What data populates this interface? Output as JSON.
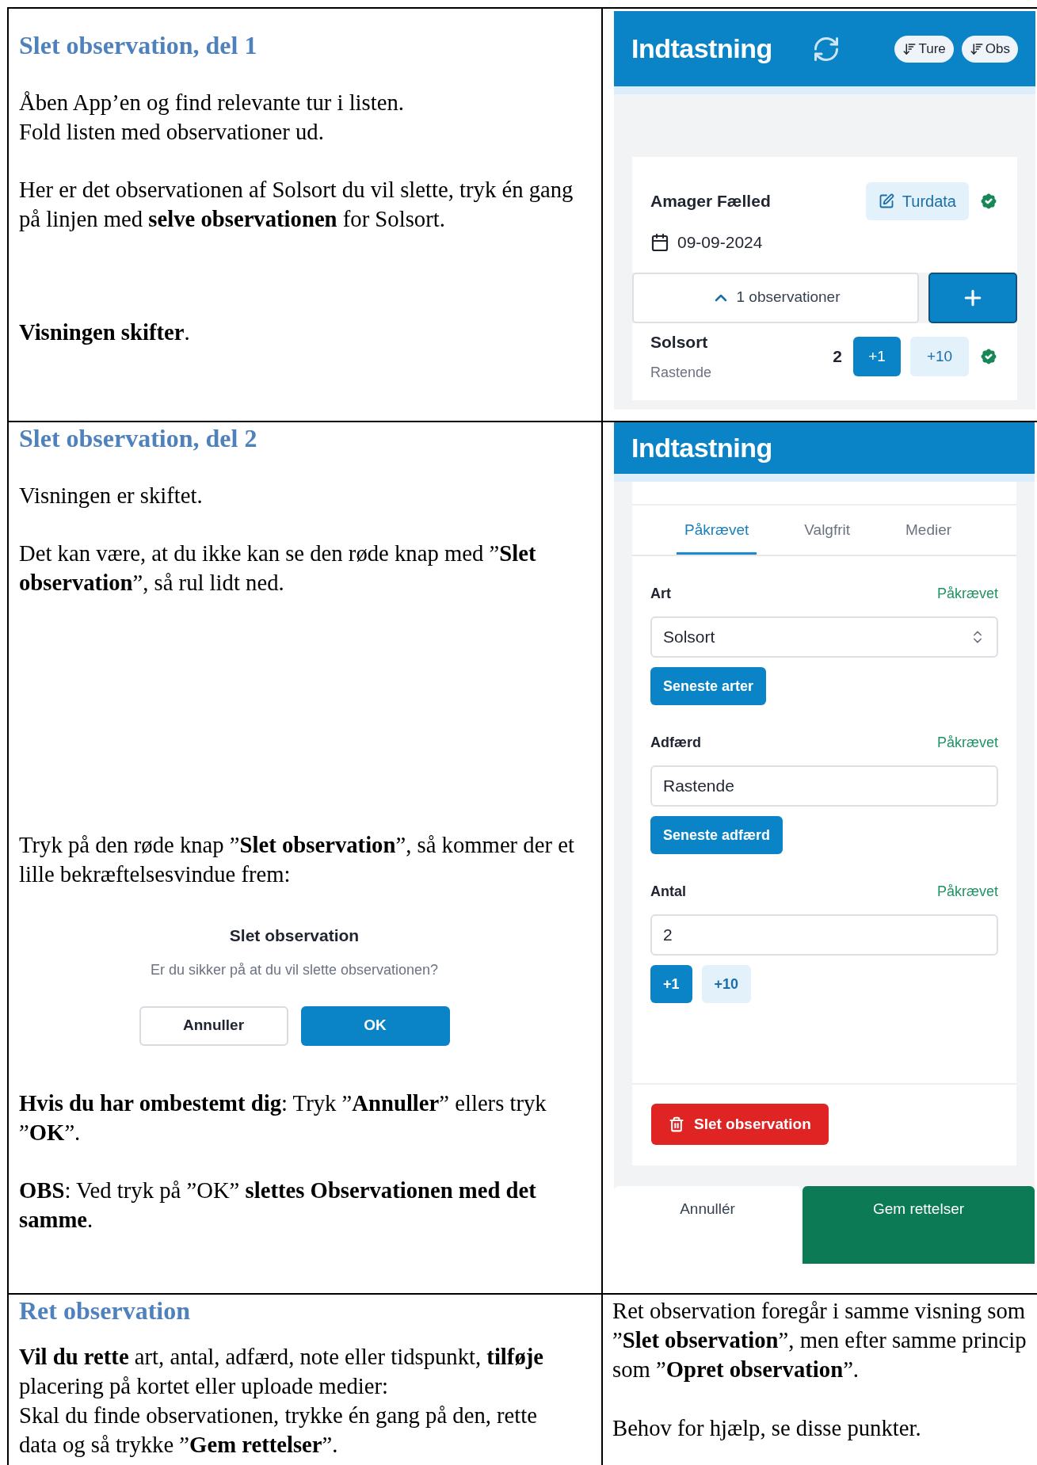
{
  "rows": [
    {
      "left": {
        "heading": "Slet observation, del 1",
        "blocks": [
          {
            "kind": "paragraph",
            "text": "Åben App’en og find relevante tur i listen."
          },
          {
            "kind": "paragraph",
            "text": "Fold listen med observationer ud."
          },
          {
            "kind": "paragraph",
            "text": "Her er det observationen af Solsort du vil slette, tryk én gang på linjen med **selve observationen** for Solsort."
          },
          {
            "kind": "paragraph",
            "text": "**Visningen skifter**."
          }
        ]
      },
      "right": {
        "kind": "trip_list",
        "title": "Indtastning",
        "sort_buttons": [
          "Ture",
          "Obs"
        ],
        "trip": {
          "name": "Amager Fælled",
          "edit_button": "Turdata",
          "date": "09-09-2024",
          "toggle": {
            "label": "1 observationer",
            "expanded": true
          },
          "observations": [
            {
              "species": "Solsort",
              "behaviour": "Rastende",
              "count": "2",
              "buttons": [
                "+1",
                "+10"
              ]
            }
          ]
        }
      }
    },
    {
      "left": {
        "heading": "Slet observation, del 2",
        "blocks": [
          {
            "kind": "paragraph",
            "text": "Visningen er skiftet."
          },
          {
            "kind": "paragraph",
            "text": "Det kan være, at du ikke kan se den røde knap med ”**Slet observation**”, så rul lidt ned."
          },
          {
            "kind": "paragraph",
            "text": "Tryk på den røde knap ”**Slet observation**”, så kommer der et lille bekræftelsesvindue frem:"
          },
          {
            "kind": "dialog",
            "title": "Slet observation",
            "message": "Er du sikker på at du vil slette observationen?",
            "buttons": [
              {
                "label": "Annuller",
                "primary": false
              },
              {
                "label": "OK",
                "primary": true
              }
            ]
          },
          {
            "kind": "paragraph",
            "text": "**Hvis du har ombestemt dig**: Tryk ”**Annuller**” ellers tryk ”**OK**”."
          },
          {
            "kind": "paragraph",
            "text": "**OBS**: Ved tryk på ”OK” **slettes Observationen med det samme**."
          }
        ]
      },
      "right": {
        "kind": "edit_form",
        "title": "Indtastning",
        "tabs": [
          {
            "label": "Påkrævet",
            "selected": true
          },
          {
            "label": "Valgfrit",
            "selected": false
          },
          {
            "label": "Medier",
            "selected": false
          }
        ],
        "fields": [
          {
            "label": "Art",
            "status": "Påkrævet",
            "kind": "select",
            "value": "Solsort",
            "buttons": [
              "Seneste arter"
            ]
          },
          {
            "label": "Adfærd",
            "status": "Påkrævet",
            "kind": "text",
            "value": "Rastende",
            "buttons": [
              "Seneste adfærd"
            ]
          },
          {
            "label": "Antal",
            "status": "Påkrævet",
            "kind": "number",
            "value": "2",
            "buttons": [
              "+1",
              "+10"
            ]
          }
        ],
        "delete_button": "Slet observation",
        "footer_buttons": [
          "Annullér",
          "Gem rettelser"
        ]
      }
    },
    {
      "left": {
        "heading": "Ret observation",
        "blocks": [
          {
            "kind": "paragraph",
            "text": "**Vil du rette** art, antal, adfærd, note eller tidspunkt, **tilføje** placering på kortet eller uploade medier:"
          },
          {
            "kind": "paragraph",
            "text": "Skal du finde observationen, trykke én gang på den, rette data og så trykke ”**Gem rettelser**”."
          }
        ]
      },
      "right": {
        "kind": "text",
        "blocks": [
          {
            "kind": "paragraph",
            "text": "Ret observation foregår i samme visning som ”**Slet observation**”, men efter samme princip som ”**Opret observation**”."
          },
          {
            "kind": "paragraph",
            "text": "Behov for hjælp, se disse punkter."
          }
        ]
      }
    }
  ]
}
